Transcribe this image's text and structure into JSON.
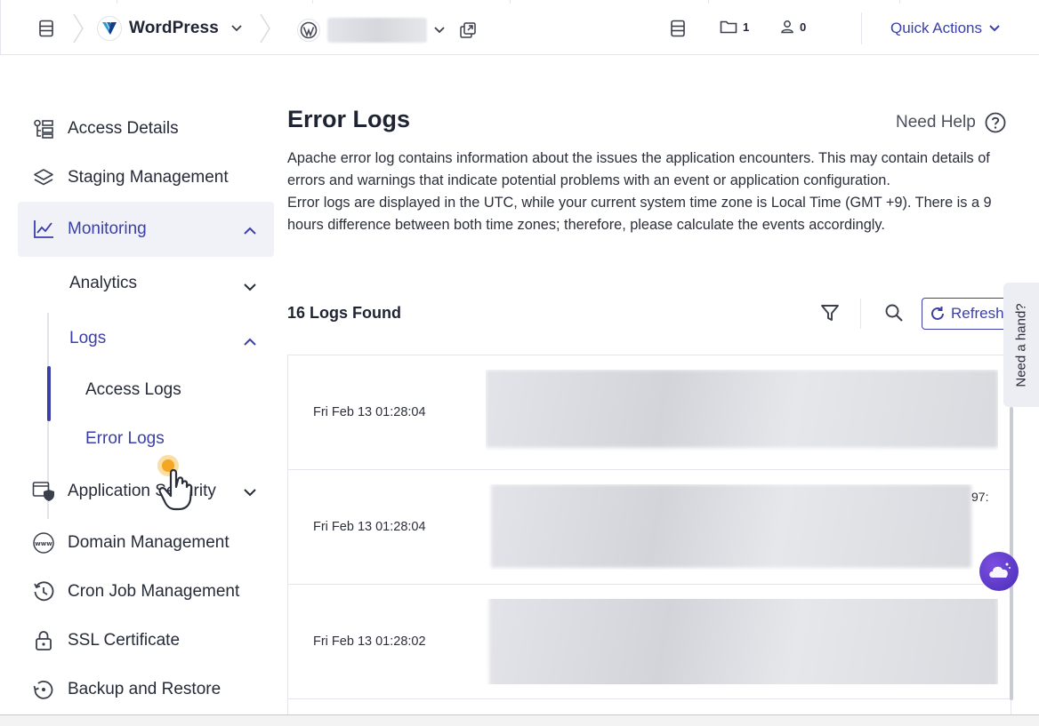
{
  "topbar": {
    "app_name": "WordPress",
    "folder_count": "1",
    "user_count": "0",
    "quick_actions_label": "Quick Actions"
  },
  "sidebar": {
    "items": [
      {
        "label": "Access Details",
        "icon": "access-details-icon"
      },
      {
        "label": "Staging Management",
        "icon": "layers-icon"
      },
      {
        "label": "Monitoring",
        "icon": "chart-line-icon",
        "expanded": true,
        "active": true
      },
      {
        "label": "Application Security",
        "icon": "shield-browser-icon"
      },
      {
        "label": "Domain Management",
        "icon": "www-icon"
      },
      {
        "label": "Cron Job Management",
        "icon": "history-clock-icon"
      },
      {
        "label": "SSL Certificate",
        "icon": "lock-icon"
      },
      {
        "label": "Backup and Restore",
        "icon": "restore-icon"
      }
    ],
    "monitoring_children": {
      "analytics": "Analytics",
      "logs": "Logs",
      "access_logs": "Access Logs",
      "error_logs": "Error Logs"
    }
  },
  "main": {
    "title": "Error Logs",
    "help_label": "Need Help",
    "description_p1": "Apache error log contains information about the issues the application encounters. This may contain details of errors and warnings that indicate potential problems with an event or application configuration.",
    "description_p2": "Error logs are displayed in the UTC, while your current system time zone is Local Time (GMT +9). There is a 9 hours difference between both time zones; therefore, please calculate the events accordingly.",
    "logs_found": "16 Logs Found",
    "refresh_label": "Refresh",
    "logs": [
      {
        "time": "Fri Feb 13 01:28:04"
      },
      {
        "time": "Fri Feb 13 01:28:04",
        "visible_fragment": "97:"
      },
      {
        "time": "Fri Feb 13 01:28:02"
      }
    ]
  },
  "widgets": {
    "need_a_hand": "Need a hand?"
  },
  "colors": {
    "accent": "#3b3fa8",
    "active_bg": "#f1f2f8",
    "cursor_dot": "#f5a623",
    "bot": "#5b36c9"
  }
}
